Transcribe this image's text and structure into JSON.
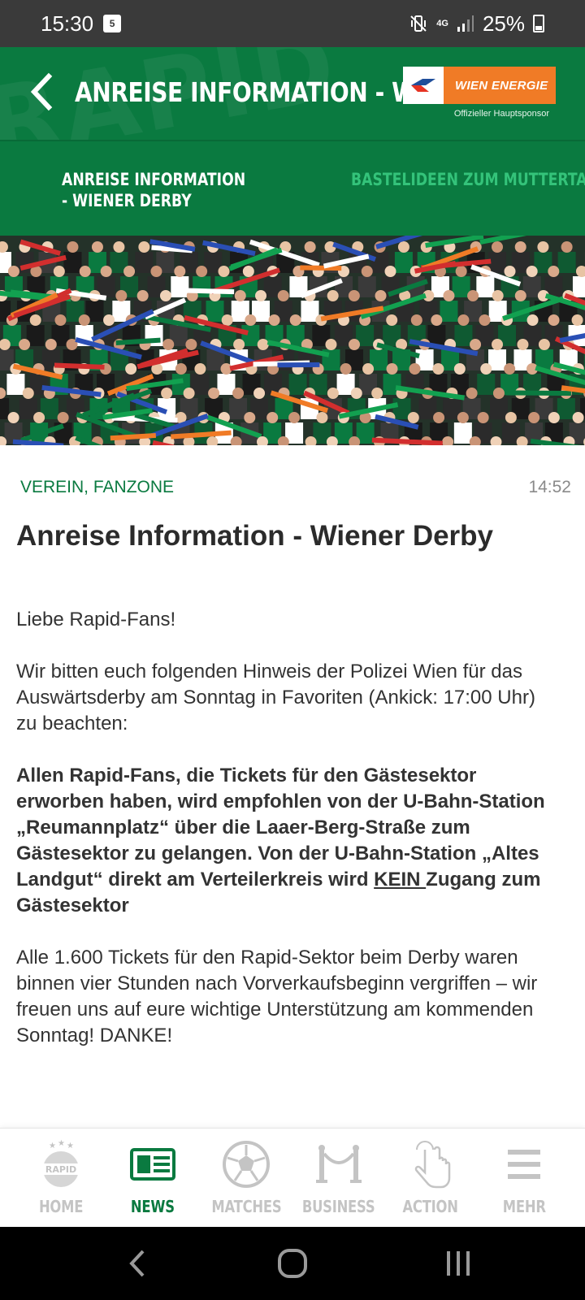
{
  "status_bar": {
    "time": "15:30",
    "calendar_day": "5",
    "network": "4G",
    "battery": "25%"
  },
  "header": {
    "title": "ANREISE INFORMATION - WI…",
    "watermark": "RAPID",
    "sponsor_name": "WIEN ENERGIE",
    "sponsor_caption": "Offizieller Hauptsponsor"
  },
  "tabs": [
    {
      "label": "ANREISE INFORMATION - WIENER DERBY",
      "active": true
    },
    {
      "label": "BASTELIDEEN ZUM MUTTERTAG",
      "active": false
    }
  ],
  "article": {
    "category": "VEREIN, FANZONE",
    "time": "14:52",
    "title": "Anreise Information - Wiener Derby",
    "greeting": "Liebe Rapid-Fans!",
    "intro": "Wir bitten euch folgenden Hinweis der Polizei Wien für das Auswärtsderby am Sonntag in Favoriten (Ankick: 17:00 Uhr) zu beachten:",
    "notice_part1": "Allen Rapid-Fans, die Tickets für den Gästesektor erworben haben, wird empfohlen von der U-Bahn-Station „Reumannplatz“ über die Laaer-Berg-Straße zum Gästesektor zu gelangen. Von der U-Bahn-Station „Altes Landgut“ direkt am Verteilerkreis wird ",
    "notice_emphasis": "KEIN ",
    "notice_part2": "Zugang zum Gästesektor",
    "closing": "Alle 1.600 Tickets für den Rapid-Sektor beim Derby waren binnen vier Stunden nach Vorverkaufsbeginn vergriffen – wir freuen uns auf eure wichtige Unterstützung am kommenden Sonntag! DANKE!"
  },
  "bottom_nav": [
    {
      "label": "HOME",
      "icon": "rapid-crest-icon"
    },
    {
      "label": "NEWS",
      "icon": "newspaper-icon",
      "active": true
    },
    {
      "label": "MATCHES",
      "icon": "soccer-ball-icon"
    },
    {
      "label": "BUSINESS",
      "icon": "rope-barrier-icon"
    },
    {
      "label": "ACTION",
      "icon": "tap-hand-icon"
    },
    {
      "label": "MEHR",
      "icon": "menu-icon"
    }
  ],
  "colors": {
    "brand_green": "#0a7a40",
    "light_green": "#34c37a",
    "sponsor_orange": "#f07b26",
    "inactive_gray": "#c4c4c4"
  }
}
